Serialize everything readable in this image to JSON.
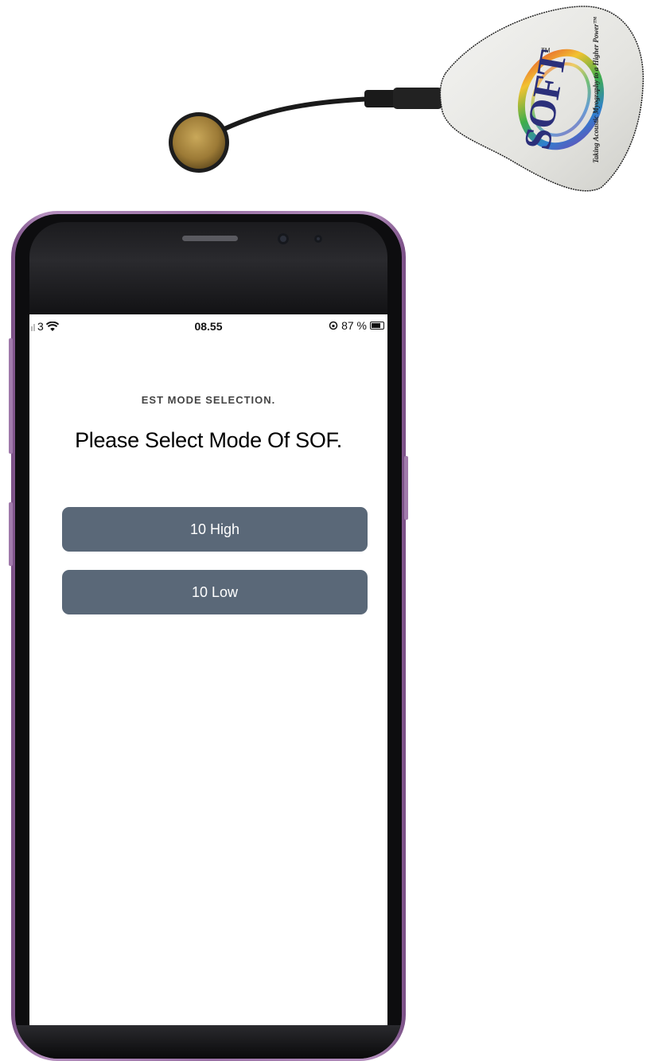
{
  "status_bar": {
    "carrier": "3",
    "time": "08.55",
    "battery_text": "87 %",
    "battery_level": 0.87,
    "icons": [
      "signal-icon",
      "wifi-icon",
      "rotation-lock-icon",
      "battery-icon"
    ]
  },
  "screen": {
    "subtitle": "EST MODE SELECTION.",
    "heading": "Please Select Mode Of SOF."
  },
  "mode_buttons": [
    {
      "label": "10 High"
    },
    {
      "label": "10 Low"
    }
  ],
  "device": {
    "logo_text": "SOFT",
    "tagline": "Taking Acoustic Myography to a Higher Power™",
    "trademark": "TM"
  },
  "colors": {
    "button_bg": "#5a6878",
    "phone_frame": "#9a71a5"
  }
}
